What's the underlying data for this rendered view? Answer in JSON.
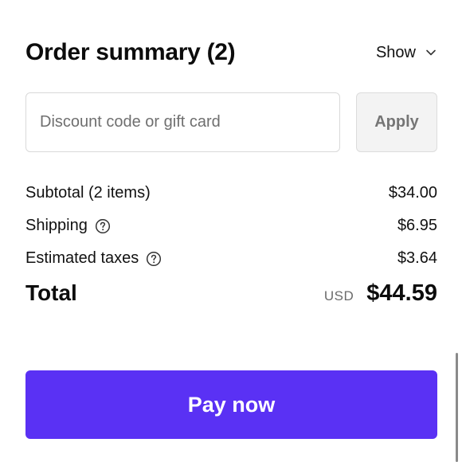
{
  "order_summary": {
    "title": "Order summary (2)",
    "toggle_label": "Show",
    "toggle_icon": "chevron-down-icon"
  },
  "discount": {
    "placeholder": "Discount code or gift card",
    "value": "",
    "apply_label": "Apply"
  },
  "lines": [
    {
      "label": "Subtotal (2 items)",
      "value": "$34.00"
    },
    {
      "label": "Shipping",
      "value": "$6.95",
      "icon": "help-circle-icon"
    },
    {
      "label": "Estimated taxes",
      "value": "$3.64",
      "icon": "help-circle-icon"
    }
  ],
  "total": {
    "label": "Total",
    "currency": "USD",
    "amount": "$44.59"
  },
  "pay_button": {
    "label": "Pay now",
    "color": "#5a31f4"
  }
}
